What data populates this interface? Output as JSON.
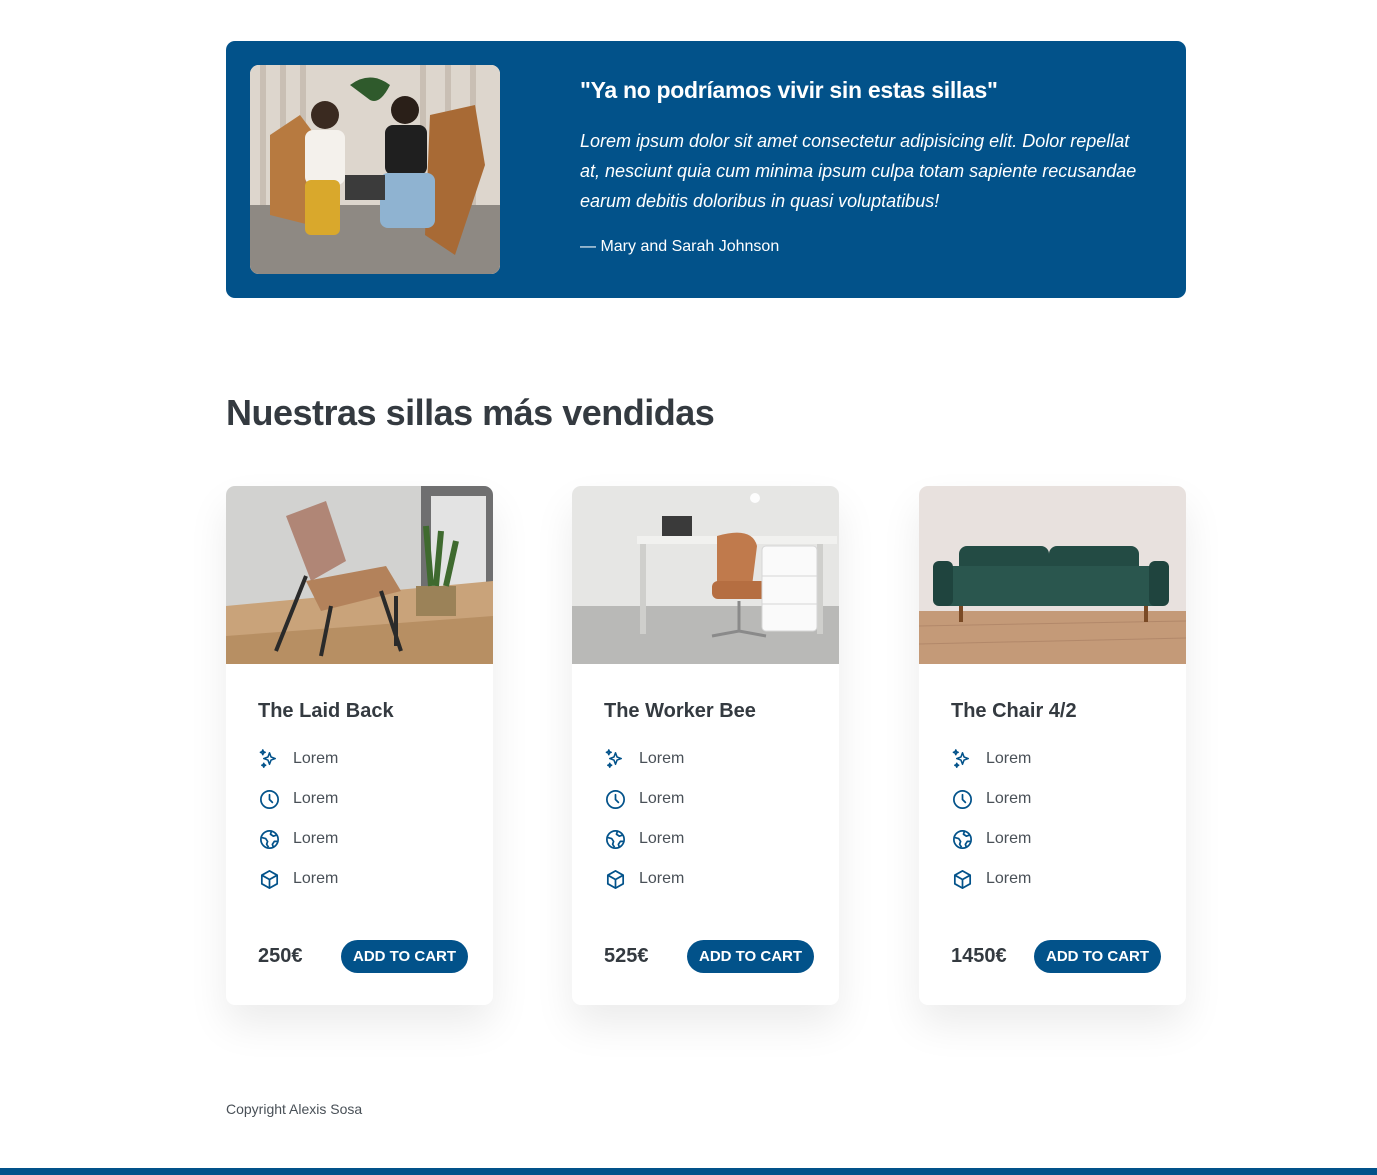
{
  "testimonial": {
    "quote": "\"Ya no podríamos vivir sin estas sillas\"",
    "body": "Lorem ipsum dolor sit amet consectetur adipisicing elit. Dolor repellat at, nesciunt quia cum minima ipsum culpa totam sapiente recusandae earum debitis doloribus in quasi voluptatibus!",
    "author": "— Mary and Sarah Johnson"
  },
  "section": {
    "title": "Nuestras sillas más vendidas"
  },
  "products": [
    {
      "name": "The Laid Back",
      "price": "250€",
      "features": [
        "Lorem",
        "Lorem",
        "Lorem",
        "Lorem"
      ],
      "cta": "ADD TO CART"
    },
    {
      "name": "The Worker Bee",
      "price": "525€",
      "features": [
        "Lorem",
        "Lorem",
        "Lorem",
        "Lorem"
      ],
      "cta": "ADD TO CART"
    },
    {
      "name": "The Chair 4/2",
      "price": "1450€",
      "features": [
        "Lorem",
        "Lorem",
        "Lorem",
        "Lorem"
      ],
      "cta": "ADD TO CART"
    }
  ],
  "feature_icons": [
    "sparkles-icon",
    "clock-icon",
    "globe-icon",
    "cube-icon"
  ],
  "footer": {
    "copyright": "Copyright Alexis Sosa"
  },
  "colors": {
    "primary": "#02528a",
    "text_dark": "#343a40"
  }
}
